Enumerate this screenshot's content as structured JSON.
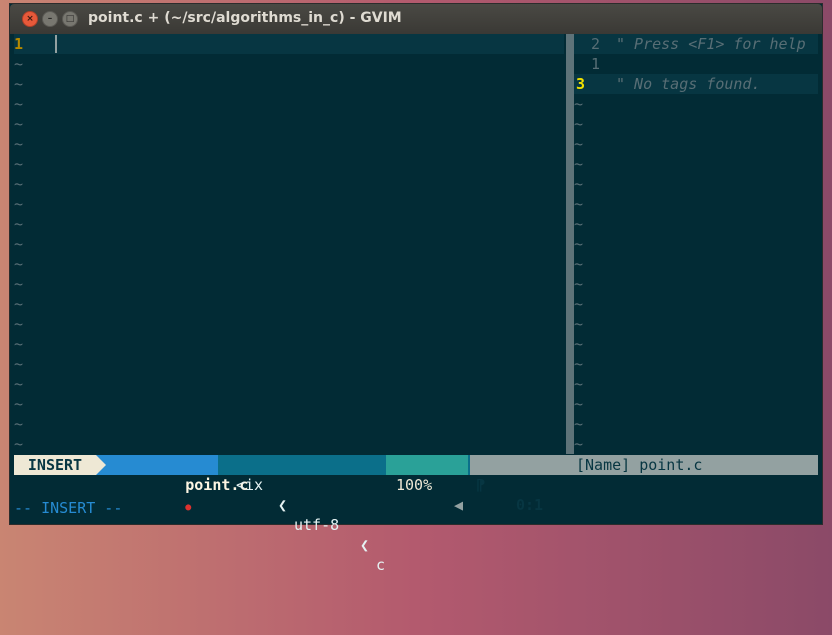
{
  "window": {
    "title": "point.c + (~/src/algorithms_in_c) - GVIM",
    "buttons": [
      "close",
      "minimize",
      "maximize"
    ]
  },
  "left_pane": {
    "line_number": "1",
    "filler": "~"
  },
  "right_pane": {
    "lines": [
      {
        "num": "2",
        "text": "\" Press <F1> for help",
        "current": false
      },
      {
        "num": "1",
        "text": "",
        "current": false
      },
      {
        "num": "3",
        "text": "\" No tags found.",
        "current": true
      }
    ],
    "filler": "~"
  },
  "statusline": {
    "mode": "INSERT",
    "filename": "point.c",
    "modified_icon": "●",
    "fileformat": "<ix",
    "encoding": "utf-8",
    "filetype": "c",
    "percent": "100%",
    "position": "0:1",
    "right": "[Name] point.c"
  },
  "command_line": "-- INSERT --",
  "colors": {
    "background": "#022b35",
    "line_number": "#b58900",
    "comment": "#586e75",
    "accent": "#268bd2"
  }
}
